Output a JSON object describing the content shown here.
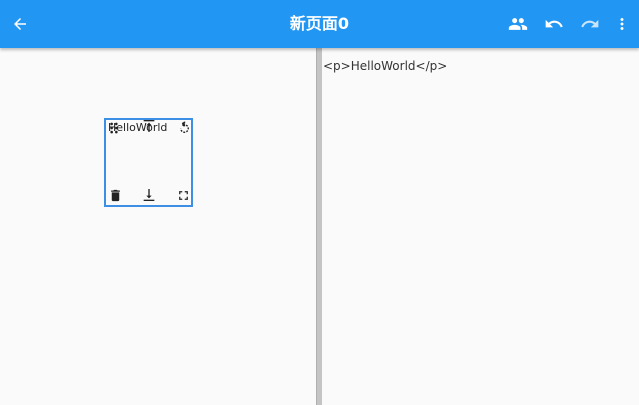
{
  "appbar": {
    "title": "新页面0",
    "background": "#2196f3",
    "icons": [
      "arrow-back-icon",
      "people-icon",
      "undo-icon",
      "redo-icon",
      "more-vert-icon"
    ]
  },
  "canvas": {
    "widget": {
      "text": "HelloWorld",
      "border_color": "#3d8fe6",
      "handles": [
        "drag-icon",
        "align-top-icon",
        "rotate-icon",
        "delete-icon",
        "align-bottom-icon",
        "fullscreen-icon"
      ]
    }
  },
  "source": {
    "code": "<p>HelloWorld</p>"
  }
}
